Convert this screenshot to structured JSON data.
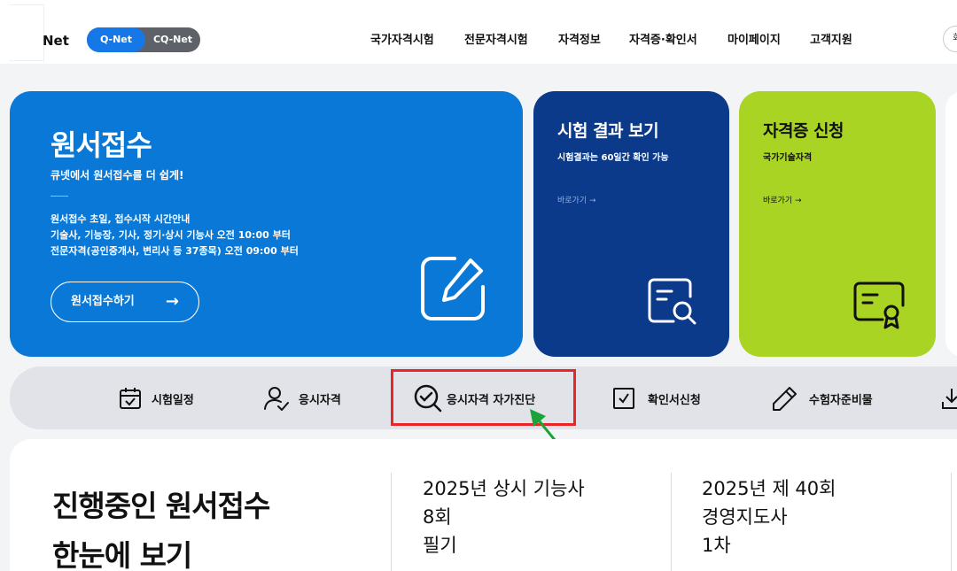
{
  "header": {
    "logo_text": "Net",
    "toggle": {
      "active": "Q-Net",
      "other": "CQ-Net"
    },
    "nav": [
      "국가자격시험",
      "전문자격시험",
      "자격정보",
      "자격증·확인서",
      "마이페이지",
      "고객지원"
    ],
    "round_button_text": "회"
  },
  "cards": {
    "main": {
      "title": "원서접수",
      "subtitle": "큐넷에서 원서접수를 더 쉽게!",
      "lines": [
        "원서접수 초일, 접수시작 시간안내",
        "기술사, 기능장, 기사, 정기·상시 기능사 오전 10:00 부터",
        "전문자격(공인중개사, 변리사 등 37종목) 오전 09:00 부터"
      ],
      "button_label": "원서접수하기",
      "button_arrow": "→",
      "icon": "edit-icon"
    },
    "result": {
      "title": "시험 결과 보기",
      "subtitle": "시험결과는 60일간 확인 가능",
      "link": "바로가기 →",
      "icon": "document-search-icon"
    },
    "cert": {
      "title": "자격증 신청",
      "subtitle": "국가기술자격",
      "link": "바로가기 →",
      "icon": "certificate-icon"
    }
  },
  "quickmenu": [
    {
      "label": "시험일정",
      "icon": "calendar-check-icon"
    },
    {
      "label": "응시자격",
      "icon": "user-check-icon"
    },
    {
      "label": "응시자격 자가진단",
      "icon": "circle-check-icon"
    },
    {
      "label": "확인서신청",
      "icon": "checkbox-icon"
    },
    {
      "label": "수험자준비물",
      "icon": "pencil-icon"
    },
    {
      "label": "",
      "icon": "download-icon"
    }
  ],
  "annotation": {
    "highlight_color": "#e8262a",
    "arrow_color": "#1aa33a"
  },
  "bottom": {
    "heading_line1": "진행중인 원서접수",
    "heading_line2": "한눈에 보기",
    "exams": [
      {
        "line1": "2025년 상시 기능사",
        "line2": "8회",
        "line3": "필기"
      },
      {
        "line1": "2025년 제 40회",
        "line2": "경영지도사",
        "line3": "1차"
      }
    ]
  },
  "colors": {
    "brand_blue": "#0a78d6",
    "navy": "#0b3a8a",
    "lime": "#a9d423",
    "toggle_active": "#1677e6"
  }
}
